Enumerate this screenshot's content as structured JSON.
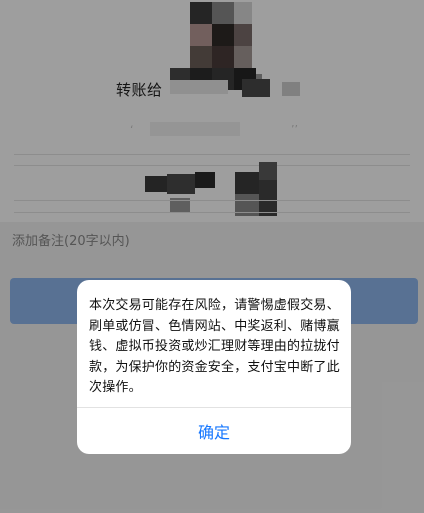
{
  "transfer": {
    "title_fragment": "转账给",
    "note_placeholder": "添加备注(20字以内)"
  },
  "alert": {
    "message": "本次交易可能存在风险，请警惕虚假交易、刷单或仿冒、色情网站、中奖返利、赌博赢钱、虚拟币投资或炒汇理财等理由的拉拢付款，为保护你的资金安全，支付宝中断了此次操作。",
    "ok_label": "确定"
  },
  "colors": {
    "accent": "#1677ff",
    "primary_button": "#8fb7ee"
  }
}
